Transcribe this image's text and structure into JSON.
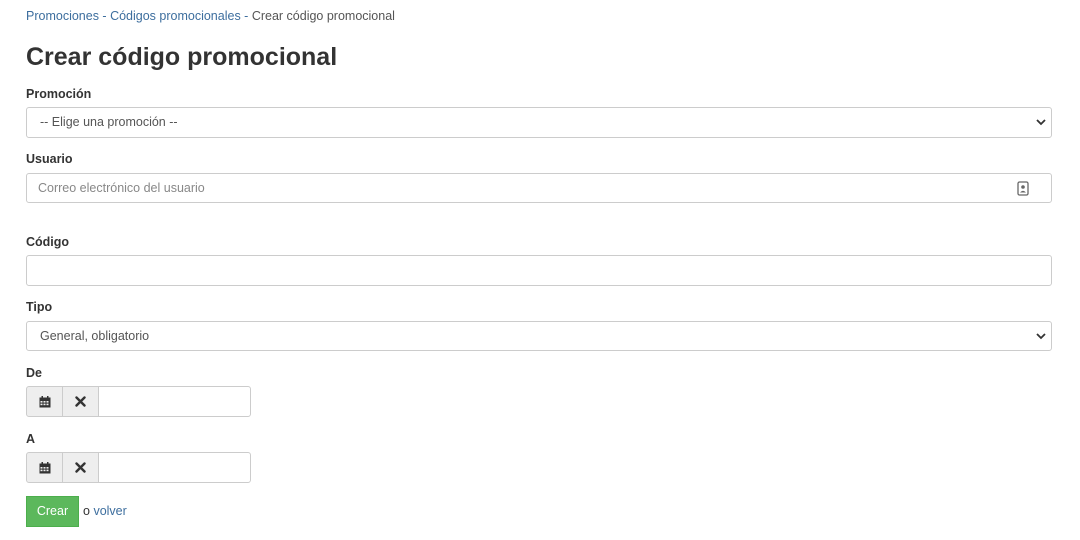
{
  "breadcrumb": {
    "items": [
      "Promociones",
      "Códigos promocionales"
    ],
    "separator": " - ",
    "current": "Crear código promocional"
  },
  "page_title": "Crear código promocional",
  "form": {
    "promotion": {
      "label": "Promoción",
      "selected": "-- Elige una promoción --",
      "icon": "chevron-down-icon"
    },
    "user": {
      "label": "Usuario",
      "placeholder": "Correo electrónico del usuario",
      "value": "",
      "icon": "contact-card-icon"
    },
    "code": {
      "label": "Código",
      "value": ""
    },
    "type": {
      "label": "Tipo",
      "selected": "General, obligatorio",
      "icon": "chevron-down-icon"
    },
    "from": {
      "label": "De",
      "value": "",
      "calendar_icon": "calendar-icon",
      "clear_icon": "close-icon"
    },
    "to": {
      "label": "A",
      "value": "",
      "calendar_icon": "calendar-icon",
      "clear_icon": "close-icon"
    },
    "submit_label": "Crear",
    "back_prefix": "o",
    "back_link": "volver"
  },
  "colors": {
    "link": "#3d6e9e",
    "primary_button": "#5cb85c",
    "border": "#cccccc",
    "addon_bg": "#eeeeee"
  }
}
